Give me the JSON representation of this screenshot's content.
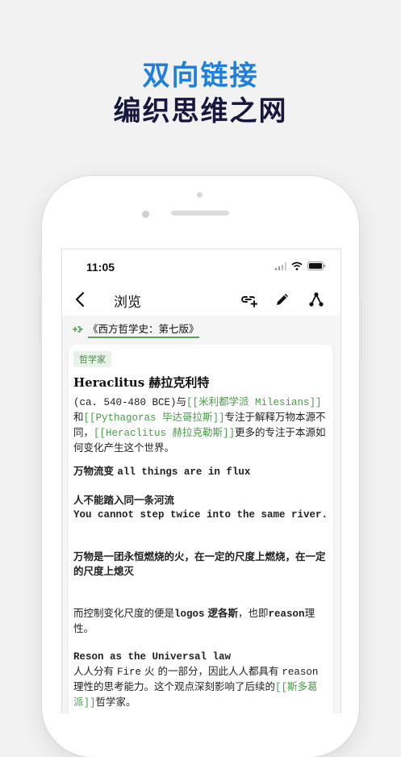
{
  "promo": {
    "headline": "双向链接",
    "subheadline": "编织思维之网"
  },
  "status_bar": {
    "time": "11:05"
  },
  "nav": {
    "title": "浏览"
  },
  "source": {
    "label": "《西方哲学史：第七版》"
  },
  "note": {
    "tag": "哲学家",
    "title": "Heraclitus 赫拉克利特",
    "intro": {
      "t1": "(ca. 540-480 BCE)与",
      "link1": "[[米利都学派 Milesians]]",
      "t2": "和",
      "link2": "[[Pythagoras 毕达哥拉斯]]",
      "t3": "专注于解释万物本源不同，",
      "link3": "[[Heraclitus 赫拉克勒斯]]",
      "t4": "更多的专注于本源如何变化产生这个世界。"
    },
    "line_flux": {
      "zh": "万物流变",
      "en": "all things are in flux"
    },
    "river_zh": "人不能踏入同一条河流",
    "river_en": "You cannot step twice into the same river.",
    "fire": "万物是一团永恒燃烧的火，在一定的尺度上燃烧，在一定的尺度上熄灭",
    "logos": {
      "t1": "而控制变化尺度的便是",
      "b1": "logos",
      "t2": "逻各斯",
      "t3": "，也即",
      "b2": "reason",
      "t4": "理性。"
    },
    "reason_heading": "Reson as the Universal law",
    "reason_body": {
      "t1": "人人分有 ",
      "m1": "Fire",
      "t2": " 火 的一部分，因此人人都具有 ",
      "m2": "reason",
      "t3": " 理性的思考能力。这个观点深刻影响了后续的",
      "link": "[[斯多葛派]]",
      "t4": "哲学家。"
    }
  },
  "colors": {
    "accent_blue": "#1f7fdb",
    "navy": "#16183f",
    "link_green": "#4c9a4c"
  }
}
